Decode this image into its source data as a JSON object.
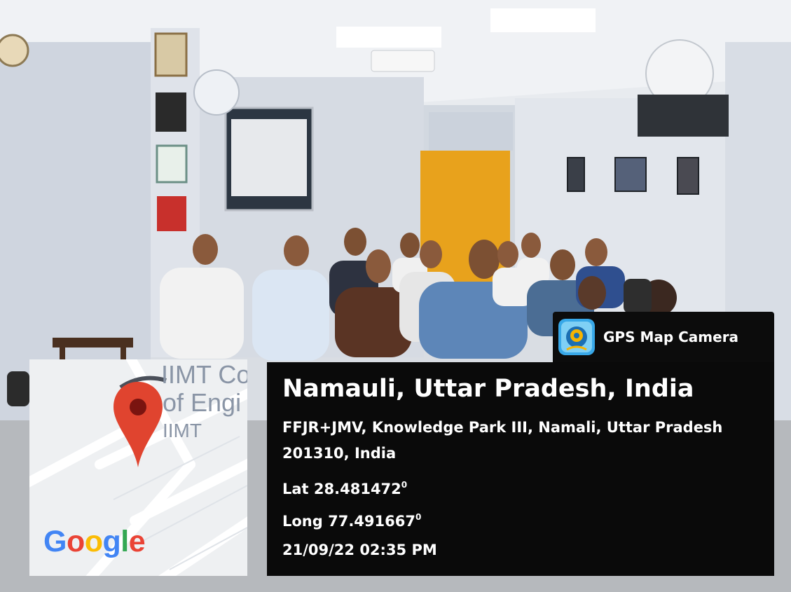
{
  "photo": {
    "description_icon": "classroom-photo"
  },
  "map": {
    "labels": [
      "IIMT Co",
      "of Engi",
      "IIMT"
    ],
    "pin_color": "#e0442f",
    "logo_letters": [
      {
        "ch": "G",
        "color": "#4285F4"
      },
      {
        "ch": "o",
        "color": "#EA4335"
      },
      {
        "ch": "o",
        "color": "#FBBC05"
      },
      {
        "ch": "g",
        "color": "#4285F4"
      },
      {
        "ch": "l",
        "color": "#34A853"
      },
      {
        "ch": "e",
        "color": "#EA4335"
      }
    ]
  },
  "badge": {
    "icon": "gps-map-camera-icon",
    "app_name": "GPS Map Camera"
  },
  "info": {
    "place": "Namauli, Uttar Pradesh, India",
    "address": "FFJR+JMV, Knowledge Park III, Namali, Uttar Pradesh 201310, India",
    "lat_label": "Lat 28.481472",
    "long_label": "Long 77.491667",
    "degree_mark": "0",
    "datetime": "21/09/22 02:35 PM"
  }
}
